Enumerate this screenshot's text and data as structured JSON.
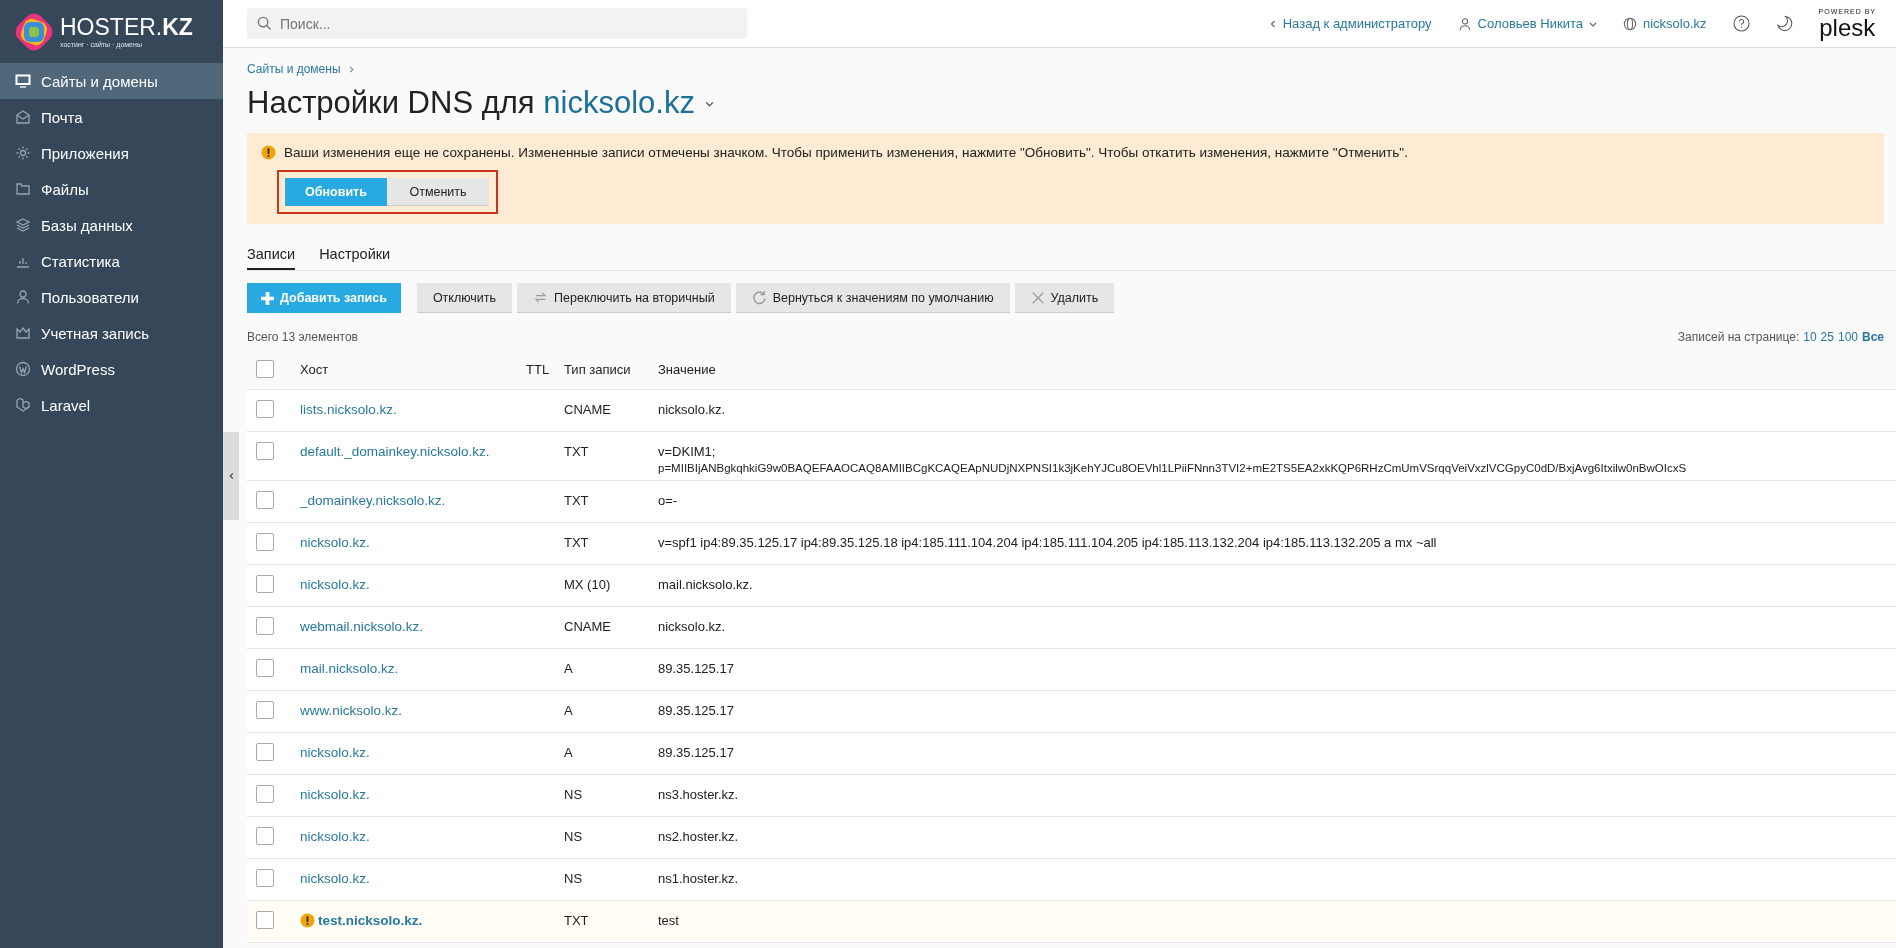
{
  "logo": {
    "brand": "HOSTER.",
    "brand_bold": "KZ",
    "tagline": "хостинг · сайты · домены"
  },
  "search": {
    "placeholder": "Поиск..."
  },
  "topbar": {
    "back": "Назад к администратору",
    "user": "Соловьев Никита",
    "domain": "nicksolo.kz",
    "powered": "POWERED BY",
    "plesk": "plesk"
  },
  "sidebar": {
    "items": [
      {
        "label": "Сайты и домены",
        "selected": true
      },
      {
        "label": "Почта",
        "selected": false
      },
      {
        "label": "Приложения",
        "selected": false
      },
      {
        "label": "Файлы",
        "selected": false
      },
      {
        "label": "Базы данных",
        "selected": false
      },
      {
        "label": "Статистика",
        "selected": false
      },
      {
        "label": "Пользователи",
        "selected": false
      },
      {
        "label": "Учетная запись",
        "selected": false
      },
      {
        "label": "WordPress",
        "selected": false
      },
      {
        "label": "Laravel",
        "selected": false
      }
    ]
  },
  "breadcrumb": "Сайты и домены",
  "title": {
    "text": "Настройки DNS для ",
    "domain": "nicksolo.kz"
  },
  "warning": {
    "message": "Ваши изменения еще не сохранены. Измененные записи отмечены значком. Чтобы применить изменения, нажмите \"Обновить\". Чтобы откатить изменения, нажмите \"Отменить\".",
    "buttons": [
      {
        "label": "Обновить",
        "kind": "primary"
      },
      {
        "label": "Отменить",
        "kind": "secondary"
      }
    ]
  },
  "tabs": [
    {
      "label": "Записи",
      "selected": true
    },
    {
      "label": "Настройки",
      "selected": false
    }
  ],
  "toolbar": [
    {
      "label": "Добавить запись",
      "kind": "primary"
    },
    {
      "label": "Отключить",
      "kind": "plain"
    },
    {
      "label": "Переключить на вторичный",
      "kind": "plain"
    },
    {
      "label": "Вернуться к значениям по умолчанию",
      "kind": "plain"
    },
    {
      "label": "Удалить",
      "kind": "plain"
    }
  ],
  "total": "Всего 13 элементов",
  "per_page": {
    "label": "Записей на странице:",
    "options": [
      {
        "label": "10",
        "selected": false
      },
      {
        "label": "25",
        "selected": false
      },
      {
        "label": "100",
        "selected": false
      },
      {
        "label": "Все",
        "selected": true
      }
    ]
  },
  "table": {
    "select_all_checked": false,
    "columns": [
      "Хост",
      "TTL",
      "Тип записи",
      "Значение"
    ],
    "rows": [
      {
        "host": "lists.nicksolo.kz.",
        "type": "CNAME",
        "value": [
          "nicksolo.kz."
        ],
        "checked": false,
        "modified": false
      },
      {
        "host": "default._domainkey.nicksolo.kz.",
        "type": "TXT",
        "value": [
          "v=DKIM1;",
          "p=MIIBIjANBgkqhkiG9w0BAQEFAAOCAQ8AMIIBCgKCAQEApNUDjNXPNSI1k3jKehYJCu8OEVhl1LPiiFNnn3TVI2+mE2TS5EA2xkKQP6RHzCmUmVSrqqVeiVxzlVCGpyC0dD/BxjAvg6Itxilw0nBwOIcxS"
        ],
        "checked": false,
        "modified": false
      },
      {
        "host": "_domainkey.nicksolo.kz.",
        "type": "TXT",
        "value": [
          "o=-"
        ],
        "checked": false,
        "modified": false
      },
      {
        "host": "nicksolo.kz.",
        "type": "TXT",
        "value": [
          "v=spf1 ip4:89.35.125.17 ip4:89.35.125.18 ip4:185.111.104.204 ip4:185.111.104.205 ip4:185.113.132.204 ip4:185.113.132.205 a mx ~all"
        ],
        "checked": false,
        "modified": false
      },
      {
        "host": "nicksolo.kz.",
        "type": "MX (10)",
        "value": [
          "mail.nicksolo.kz."
        ],
        "checked": false,
        "modified": false
      },
      {
        "host": "webmail.nicksolo.kz.",
        "type": "CNAME",
        "value": [
          "nicksolo.kz."
        ],
        "checked": false,
        "modified": false
      },
      {
        "host": "mail.nicksolo.kz.",
        "type": "A",
        "value": [
          "89.35.125.17"
        ],
        "checked": false,
        "modified": false
      },
      {
        "host": "www.nicksolo.kz.",
        "type": "A",
        "value": [
          "89.35.125.17"
        ],
        "checked": false,
        "modified": false
      },
      {
        "host": "nicksolo.kz.",
        "type": "A",
        "value": [
          "89.35.125.17"
        ],
        "checked": false,
        "modified": false
      },
      {
        "host": "nicksolo.kz.",
        "type": "NS",
        "value": [
          "ns3.hoster.kz."
        ],
        "checked": false,
        "modified": false
      },
      {
        "host": "nicksolo.kz.",
        "type": "NS",
        "value": [
          "ns2.hoster.kz."
        ],
        "checked": false,
        "modified": false
      },
      {
        "host": "nicksolo.kz.",
        "type": "NS",
        "value": [
          "ns1.hoster.kz."
        ],
        "checked": false,
        "modified": false
      },
      {
        "host": "test.nicksolo.kz.",
        "type": "TXT",
        "value": [
          "test"
        ],
        "checked": false,
        "modified": true
      }
    ]
  }
}
